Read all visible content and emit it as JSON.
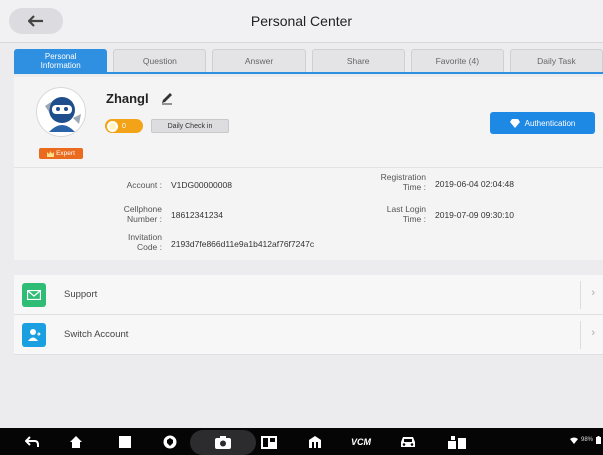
{
  "header": {
    "title": "Personal Center"
  },
  "tabs": [
    {
      "label": "Personal Information",
      "active": true
    },
    {
      "label": "Question",
      "active": false
    },
    {
      "label": "Answer",
      "active": false
    },
    {
      "label": "Share",
      "active": false
    },
    {
      "label": "Favorite (4)",
      "active": false
    },
    {
      "label": "Daily Task",
      "active": false
    }
  ],
  "profile": {
    "username": "Zhangl",
    "coins": "0",
    "checkin_label": "Daily Check in",
    "badge": "Expert",
    "auth_label": "Authentication"
  },
  "info": {
    "account_label": "Account :",
    "account_value": "V1DG00000008",
    "phone_label_1": "Cellphone",
    "phone_label_2": "Number :",
    "phone_value": "18612341234",
    "invite_label_1": "Invitation",
    "invite_label_2": "Code :",
    "invite_value": "2193d7fe866d11e9a1b412af76f7247c",
    "reg_label_1": "Registration",
    "reg_label_2": "Time :",
    "reg_value": "2019-06-04 02:04:48",
    "login_label_1": "Last Login",
    "login_label_2": "Time :",
    "login_value": "2019-07-09 09:30:10"
  },
  "list": [
    {
      "label": "Support",
      "icon": "mail-icon",
      "color": "#2fbd76"
    },
    {
      "label": "Switch Account",
      "icon": "user-switch-icon",
      "color": "#1a9fe0"
    }
  ],
  "navbar": {
    "vci_label": "VCM",
    "status_text": "98%"
  },
  "colors": {
    "accent": "#2f8fe0",
    "expert": "#ea6a1e",
    "coin": "#f2a318"
  }
}
